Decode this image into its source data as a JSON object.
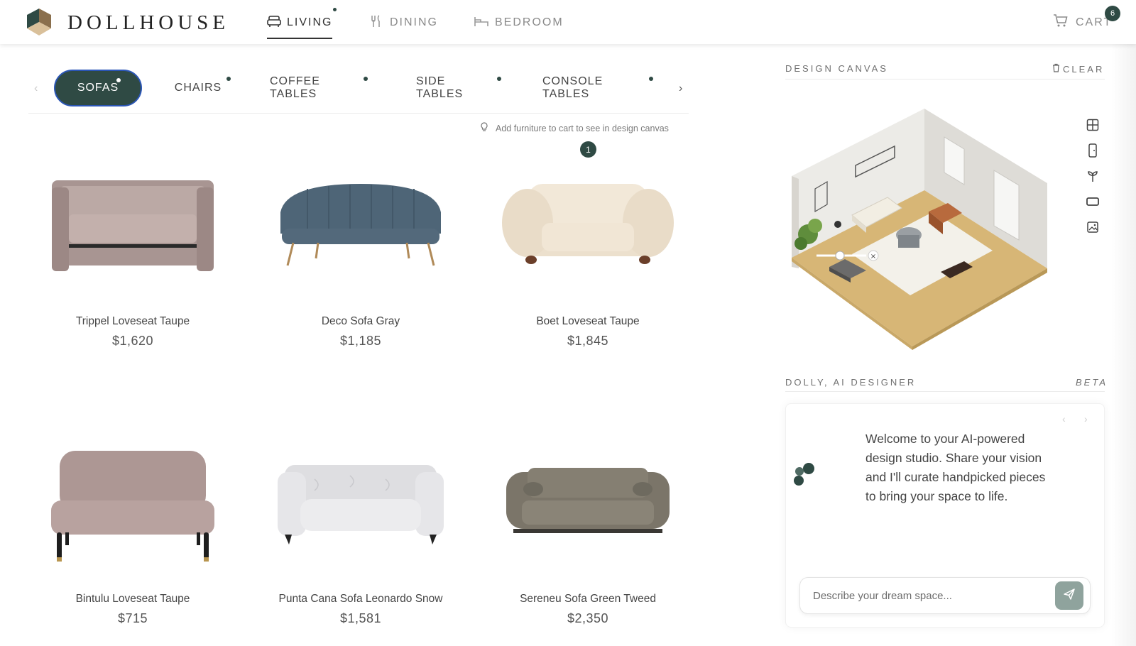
{
  "brand": {
    "name": "DOLLHOUSE"
  },
  "nav": {
    "items": [
      {
        "label": "LIVING",
        "icon": "sofa-icon",
        "active": true
      },
      {
        "label": "DINING",
        "icon": "fork-knife-icon",
        "active": false
      },
      {
        "label": "BEDROOM",
        "icon": "bed-icon",
        "active": false
      }
    ],
    "cart": {
      "label": "CART",
      "count": "6"
    }
  },
  "categories": {
    "tabs": [
      {
        "label": "SOFAS",
        "active": true
      },
      {
        "label": "CHAIRS",
        "active": false
      },
      {
        "label": "COFFEE TABLES",
        "active": false
      },
      {
        "label": "SIDE TABLES",
        "active": false
      },
      {
        "label": "CONSOLE TABLES",
        "active": false
      }
    ]
  },
  "hint": {
    "text": "Add furniture to cart to see in design canvas",
    "badge": "1"
  },
  "products": [
    {
      "name": "Trippel Loveseat Taupe",
      "price": "$1,620",
      "color": "#b6a4a0"
    },
    {
      "name": "Deco Sofa Gray",
      "price": "$1,185",
      "color": "#4f6678"
    },
    {
      "name": "Boet Loveseat Taupe",
      "price": "$1,845",
      "color": "#efe4d3"
    },
    {
      "name": "Bintulu Loveseat Taupe",
      "price": "$715",
      "color": "#b39b98"
    },
    {
      "name": "Punta Cana Sofa Leonardo Snow",
      "price": "$1,581",
      "color": "#e7e7e9"
    },
    {
      "name": "Sereneu Sofa Green Tweed",
      "price": "$2,350",
      "color": "#7a7468"
    }
  ],
  "canvas": {
    "heading": "DESIGN CANVAS",
    "clear_label": "CLEAR"
  },
  "assistant": {
    "heading": "DOLLY, AI DESIGNER",
    "badge": "BETA",
    "message": "Welcome to your AI-powered design studio. Share your vision and I'll curate handpicked pieces to bring your space to life.",
    "input_placeholder": "Describe your dream space..."
  },
  "colors": {
    "accent": "#2f4a44",
    "focus_ring": "#2b56b6",
    "send_button": "#8fa39d"
  }
}
